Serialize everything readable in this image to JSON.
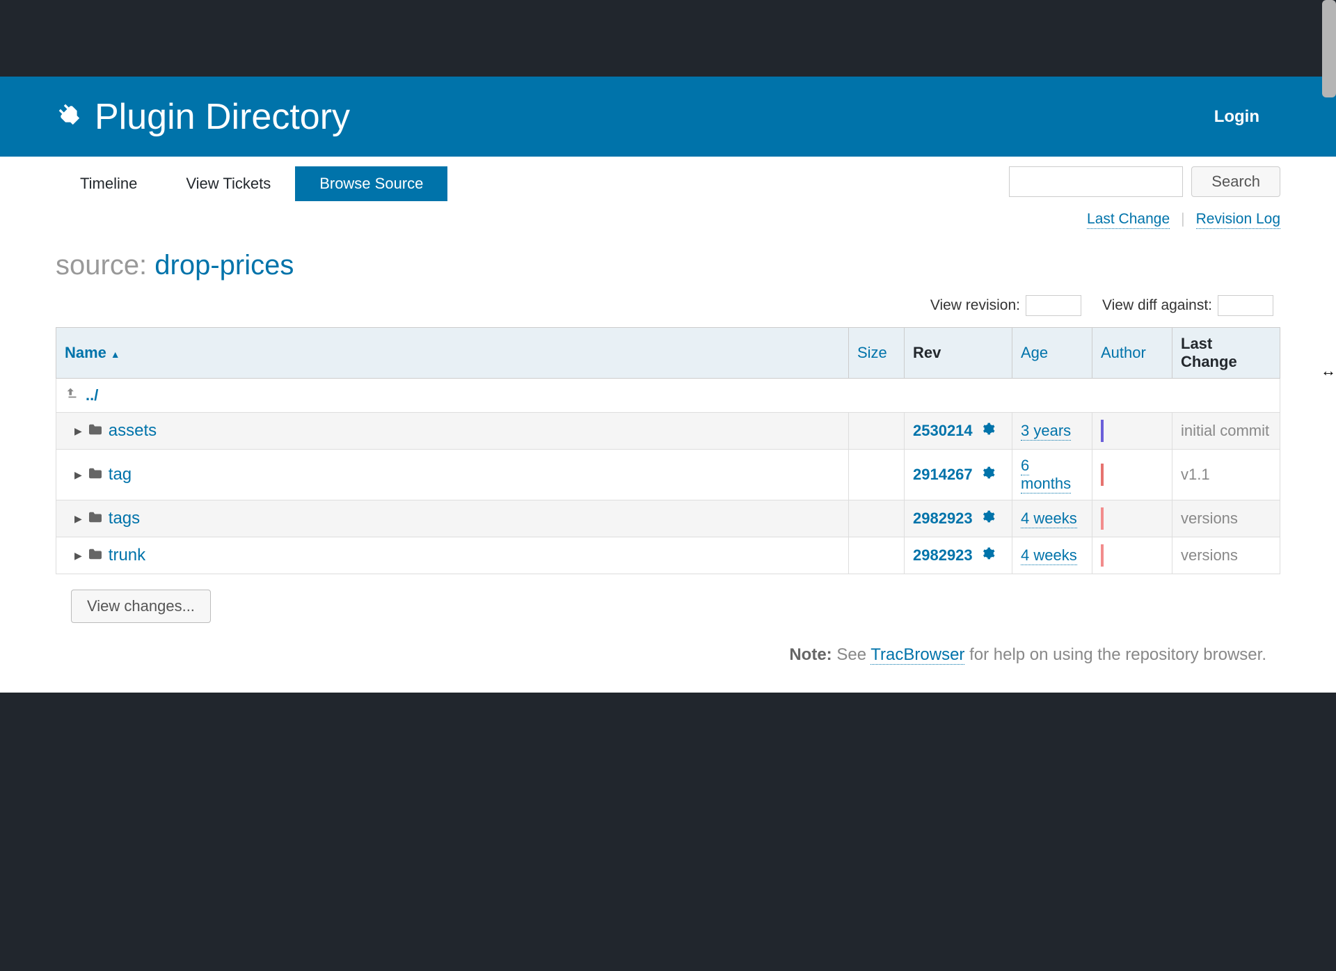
{
  "header": {
    "title": "Plugin Directory",
    "login_label": "Login"
  },
  "nav": {
    "tabs": [
      {
        "label": "Timeline",
        "active": false
      },
      {
        "label": "View Tickets",
        "active": false
      },
      {
        "label": "Browse Source",
        "active": true
      }
    ],
    "search_button": "Search"
  },
  "sublinks": {
    "last_change": "Last Change",
    "revision_log": "Revision Log"
  },
  "source": {
    "prefix": "source: ",
    "name": "drop-prices"
  },
  "controls": {
    "view_revision_label": "View revision:",
    "view_diff_label": "View diff against:"
  },
  "columns": {
    "name": "Name",
    "size": "Size",
    "rev": "Rev",
    "age": "Age",
    "author": "Author",
    "last_change": "Last Change"
  },
  "parent_dir": "../",
  "rows": [
    {
      "name": "assets",
      "rev": "2530214",
      "age": "3 years",
      "bar_color": "#6b5fd9",
      "message": "initial commit"
    },
    {
      "name": "tag",
      "rev": "2914267",
      "age": "6 months",
      "bar_color": "#e6736f",
      "message": "v1.1"
    },
    {
      "name": "tags",
      "rev": "2982923",
      "age": "4 weeks",
      "bar_color": "#f28c8c",
      "message": "versions"
    },
    {
      "name": "trunk",
      "rev": "2982923",
      "age": "4 weeks",
      "bar_color": "#f28c8c",
      "message": "versions"
    }
  ],
  "view_changes_button": "View changes...",
  "note": {
    "label": "Note:",
    "prefix": " See ",
    "link": "TracBrowser",
    "suffix": " for help on using the repository browser."
  }
}
